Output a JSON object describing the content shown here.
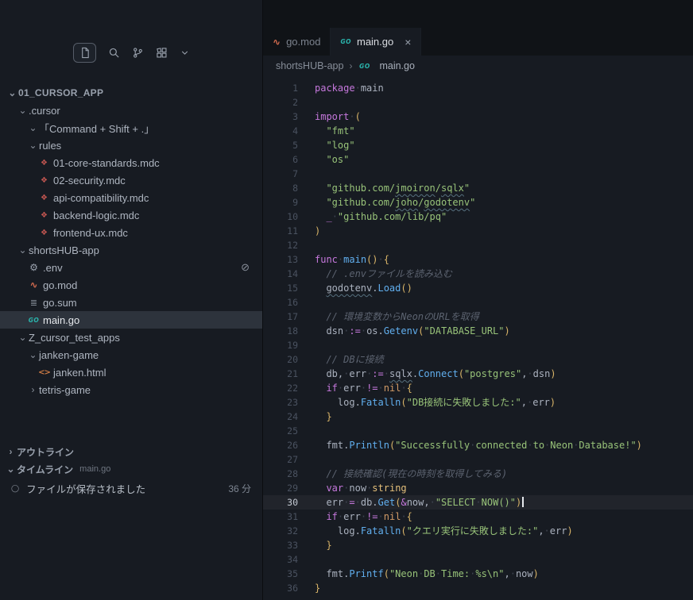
{
  "colors": {
    "keyword": "#c678dd",
    "string": "#98c379",
    "function": "#61afef",
    "comment": "#5c6370",
    "type": "#e5c07b",
    "constant": "#d19a66",
    "bracket": "#d9b468",
    "go_icon": "#2ab5ad",
    "mdc_icon": "#c05550",
    "gomod_icon": "#d36b4f",
    "html_icon": "#cd7a44",
    "selection_bg": "#2d333c",
    "editor_bg": "#171b22"
  },
  "icons": {
    "chevron": {
      "down": "⌄",
      "right": "›"
    },
    "glyphs": {
      "mdc": "❖",
      "gear": "⚙",
      "gomod": "∿",
      "gosum": "≣",
      "go": "GO",
      "html": "<>",
      "blocked": "⊘",
      "circle": "◯"
    }
  },
  "sidebar": {
    "tree": [
      {
        "label": "01_CURSOR_APP",
        "depth": 0,
        "type": "folder",
        "chevron": "down",
        "strong": true
      },
      {
        "label": ".cursor",
        "depth": 1,
        "type": "folder",
        "chevron": "down"
      },
      {
        "label": "「Command + Shift + .」",
        "depth": 2,
        "type": "folder",
        "chevron": "down"
      },
      {
        "label": "rules",
        "depth": 2,
        "type": "folder",
        "chevron": "down"
      },
      {
        "label": "01-core-standards.mdc",
        "depth": 3,
        "type": "file",
        "icon": "mdc"
      },
      {
        "label": "02-security.mdc",
        "depth": 3,
        "type": "file",
        "icon": "mdc"
      },
      {
        "label": "api-compatibility.mdc",
        "depth": 3,
        "type": "file",
        "icon": "mdc"
      },
      {
        "label": "backend-logic.mdc",
        "depth": 3,
        "type": "file",
        "icon": "mdc"
      },
      {
        "label": "frontend-ux.mdc",
        "depth": 3,
        "type": "file",
        "icon": "mdc"
      },
      {
        "label": "shortsHUB-app",
        "depth": 1,
        "type": "folder",
        "chevron": "down"
      },
      {
        "label": ".env",
        "depth": 2,
        "type": "file",
        "icon": "gear",
        "badge": "⊘"
      },
      {
        "label": "go.mod",
        "depth": 2,
        "type": "file",
        "icon": "gomod"
      },
      {
        "label": "go.sum",
        "depth": 2,
        "type": "file",
        "icon": "gosum"
      },
      {
        "label": "main.go",
        "depth": 2,
        "type": "file",
        "icon": "go",
        "selected": true
      },
      {
        "label": "Z_cursor_test_apps",
        "depth": 1,
        "type": "folder",
        "chevron": "down"
      },
      {
        "label": "janken-game",
        "depth": 2,
        "type": "folder",
        "chevron": "down"
      },
      {
        "label": "janken.html",
        "depth": 3,
        "type": "file",
        "icon": "html"
      },
      {
        "label": "tetris-game",
        "depth": 2,
        "type": "folder",
        "chevron": "right"
      }
    ],
    "outline": {
      "label": "アウトライン"
    },
    "timeline": {
      "label": "タイムライン",
      "context": "main.go",
      "item": {
        "label": "ファイルが保存されました",
        "time": "36 分"
      }
    }
  },
  "tabs": [
    {
      "label": "go.mod",
      "icon": "gomod",
      "active": false
    },
    {
      "label": "main.go",
      "icon": "go",
      "active": true,
      "close": "×"
    }
  ],
  "breadcrumb": {
    "project": "shortsHUB-app",
    "separator": "›",
    "file": "main.go"
  },
  "editor": {
    "language": "go",
    "lines": [
      {
        "n": 1,
        "t": [
          [
            "k",
            "package"
          ],
          [
            "w",
            "·"
          ],
          [
            "p",
            "main"
          ]
        ]
      },
      {
        "n": 2,
        "t": []
      },
      {
        "n": 3,
        "t": [
          [
            "k",
            "import"
          ],
          [
            "w",
            "·"
          ],
          [
            "b",
            "("
          ]
        ]
      },
      {
        "n": 4,
        "t": [
          [
            "p",
            "  "
          ],
          [
            "s",
            "\"fmt\""
          ]
        ]
      },
      {
        "n": 5,
        "t": [
          [
            "p",
            "  "
          ],
          [
            "s",
            "\"log\""
          ]
        ]
      },
      {
        "n": 6,
        "t": [
          [
            "p",
            "  "
          ],
          [
            "s",
            "\"os\""
          ]
        ]
      },
      {
        "n": 7,
        "t": []
      },
      {
        "n": 8,
        "t": [
          [
            "p",
            "  "
          ],
          [
            "s",
            "\"github.com/"
          ],
          [
            "s sp",
            "jmoiron"
          ],
          [
            "s",
            "/"
          ],
          [
            "s sp",
            "sqlx"
          ],
          [
            "s",
            "\""
          ]
        ]
      },
      {
        "n": 9,
        "t": [
          [
            "p",
            "  "
          ],
          [
            "s",
            "\"github.com/"
          ],
          [
            "s sp",
            "joho"
          ],
          [
            "s",
            "/"
          ],
          [
            "s sp",
            "godotenv"
          ],
          [
            "s",
            "\""
          ]
        ]
      },
      {
        "n": 10,
        "t": [
          [
            "p",
            "  "
          ],
          [
            "k",
            "_"
          ],
          [
            "w",
            "·"
          ],
          [
            "s",
            "\"github.com/lib/pq\""
          ]
        ]
      },
      {
        "n": 11,
        "t": [
          [
            "b",
            ")"
          ]
        ]
      },
      {
        "n": 12,
        "t": []
      },
      {
        "n": 13,
        "t": [
          [
            "k",
            "func"
          ],
          [
            "w",
            "·"
          ],
          [
            "f",
            "main"
          ],
          [
            "b",
            "()"
          ],
          [
            "w",
            "·"
          ],
          [
            "b",
            "{"
          ]
        ]
      },
      {
        "n": 14,
        "t": [
          [
            "p",
            "  "
          ],
          [
            "c",
            "// .envファイルを読み込む"
          ]
        ]
      },
      {
        "n": 15,
        "t": [
          [
            "p",
            "  "
          ],
          [
            "p sp",
            "godotenv"
          ],
          [
            "p",
            "."
          ],
          [
            "f",
            "Load"
          ],
          [
            "b",
            "()"
          ]
        ]
      },
      {
        "n": 16,
        "t": []
      },
      {
        "n": 17,
        "t": [
          [
            "p",
            "  "
          ],
          [
            "c",
            "// 環境変数からNeonのURLを取得"
          ]
        ]
      },
      {
        "n": 18,
        "t": [
          [
            "p",
            "  "
          ],
          [
            "p",
            "dsn"
          ],
          [
            "w",
            "·"
          ],
          [
            "o",
            ":="
          ],
          [
            "w",
            "·"
          ],
          [
            "p",
            "os."
          ],
          [
            "f",
            "Getenv"
          ],
          [
            "b",
            "("
          ],
          [
            "s",
            "\"DATABASE_URL\""
          ],
          [
            "b",
            ")"
          ]
        ]
      },
      {
        "n": 19,
        "t": []
      },
      {
        "n": 20,
        "t": [
          [
            "p",
            "  "
          ],
          [
            "c",
            "// DBに接続"
          ]
        ]
      },
      {
        "n": 21,
        "t": [
          [
            "p",
            "  "
          ],
          [
            "p",
            "db,"
          ],
          [
            "w",
            "·"
          ],
          [
            "p",
            "err"
          ],
          [
            "w",
            "·"
          ],
          [
            "o",
            ":="
          ],
          [
            "w",
            "·"
          ],
          [
            "p sp",
            "sqlx"
          ],
          [
            "p",
            "."
          ],
          [
            "f",
            "Connect"
          ],
          [
            "b",
            "("
          ],
          [
            "s",
            "\"postgres\""
          ],
          [
            "p",
            ","
          ],
          [
            "w",
            "·"
          ],
          [
            "p",
            "dsn"
          ],
          [
            "b",
            ")"
          ]
        ]
      },
      {
        "n": 22,
        "t": [
          [
            "p",
            "  "
          ],
          [
            "k",
            "if"
          ],
          [
            "w",
            "·"
          ],
          [
            "p",
            "err"
          ],
          [
            "w",
            "·"
          ],
          [
            "o",
            "!="
          ],
          [
            "w",
            "·"
          ],
          [
            "n",
            "nil"
          ],
          [
            "w",
            "·"
          ],
          [
            "b",
            "{"
          ]
        ]
      },
      {
        "n": 23,
        "t": [
          [
            "p",
            "    "
          ],
          [
            "p",
            "log."
          ],
          [
            "f",
            "Fatalln"
          ],
          [
            "b",
            "("
          ],
          [
            "s",
            "\"DB接続に失敗しました:\""
          ],
          [
            "p",
            ","
          ],
          [
            "w",
            "·"
          ],
          [
            "p",
            "err"
          ],
          [
            "b",
            ")"
          ]
        ]
      },
      {
        "n": 24,
        "t": [
          [
            "p",
            "  "
          ],
          [
            "b",
            "}"
          ]
        ]
      },
      {
        "n": 25,
        "t": []
      },
      {
        "n": 26,
        "t": [
          [
            "p",
            "  "
          ],
          [
            "p",
            "fmt."
          ],
          [
            "f",
            "Println"
          ],
          [
            "b",
            "("
          ],
          [
            "s",
            "\"Successfully"
          ],
          [
            "w",
            "·"
          ],
          [
            "s",
            "connected"
          ],
          [
            "w",
            "·"
          ],
          [
            "s",
            "to"
          ],
          [
            "w",
            "·"
          ],
          [
            "s",
            "Neon"
          ],
          [
            "w",
            "·"
          ],
          [
            "s",
            "Database!\""
          ],
          [
            "b",
            ")"
          ]
        ]
      },
      {
        "n": 27,
        "t": []
      },
      {
        "n": 28,
        "t": [
          [
            "p",
            "  "
          ],
          [
            "c",
            "// 接続確認(現在の時刻を取得してみる)"
          ]
        ]
      },
      {
        "n": 29,
        "t": [
          [
            "p",
            "  "
          ],
          [
            "k",
            "var"
          ],
          [
            "w",
            "·"
          ],
          [
            "p",
            "now"
          ],
          [
            "w",
            "·"
          ],
          [
            "t",
            "string"
          ]
        ]
      },
      {
        "n": 30,
        "active": true,
        "t": [
          [
            "p",
            "  "
          ],
          [
            "p",
            "err"
          ],
          [
            "w",
            "·"
          ],
          [
            "o",
            "="
          ],
          [
            "w",
            "·"
          ],
          [
            "p",
            "db."
          ],
          [
            "f",
            "Get"
          ],
          [
            "b",
            "("
          ],
          [
            "o",
            "&"
          ],
          [
            "p",
            "now,"
          ],
          [
            "w",
            "·"
          ],
          [
            "s",
            "\"SELECT"
          ],
          [
            "w",
            "·"
          ],
          [
            "s",
            "NOW()\""
          ],
          [
            "b",
            ")"
          ],
          [
            "cur",
            ""
          ]
        ]
      },
      {
        "n": 31,
        "t": [
          [
            "p",
            "  "
          ],
          [
            "k",
            "if"
          ],
          [
            "w",
            "·"
          ],
          [
            "p",
            "err"
          ],
          [
            "w",
            "·"
          ],
          [
            "o",
            "!="
          ],
          [
            "w",
            "·"
          ],
          [
            "n",
            "nil"
          ],
          [
            "w",
            "·"
          ],
          [
            "b",
            "{"
          ]
        ]
      },
      {
        "n": 32,
        "t": [
          [
            "p",
            "    "
          ],
          [
            "p",
            "log."
          ],
          [
            "f",
            "Fatalln"
          ],
          [
            "b",
            "("
          ],
          [
            "s",
            "\"クエリ実行に失敗しました:\""
          ],
          [
            "p",
            ","
          ],
          [
            "w",
            "·"
          ],
          [
            "p",
            "err"
          ],
          [
            "b",
            ")"
          ]
        ]
      },
      {
        "n": 33,
        "t": [
          [
            "p",
            "  "
          ],
          [
            "b",
            "}"
          ]
        ]
      },
      {
        "n": 34,
        "t": []
      },
      {
        "n": 35,
        "t": [
          [
            "p",
            "  "
          ],
          [
            "p",
            "fmt."
          ],
          [
            "f",
            "Printf"
          ],
          [
            "b",
            "("
          ],
          [
            "s",
            "\"Neon"
          ],
          [
            "w",
            "·"
          ],
          [
            "s",
            "DB"
          ],
          [
            "w",
            "·"
          ],
          [
            "s",
            "Time:"
          ],
          [
            "w",
            "·"
          ],
          [
            "s",
            "%s\\n\""
          ],
          [
            "p",
            ","
          ],
          [
            "w",
            "·"
          ],
          [
            "p",
            "now"
          ],
          [
            "b",
            ")"
          ]
        ]
      },
      {
        "n": 36,
        "t": [
          [
            "b",
            "}"
          ]
        ]
      }
    ]
  }
}
